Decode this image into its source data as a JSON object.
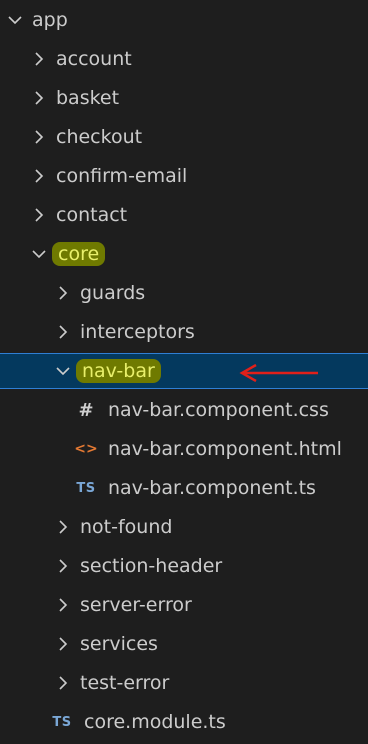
{
  "explorer": {
    "items": [
      {
        "label": "app",
        "depth": 0,
        "type": "folder",
        "expanded": true
      },
      {
        "label": "account",
        "depth": 1,
        "type": "folder",
        "expanded": false
      },
      {
        "label": "basket",
        "depth": 1,
        "type": "folder",
        "expanded": false
      },
      {
        "label": "checkout",
        "depth": 1,
        "type": "folder",
        "expanded": false
      },
      {
        "label": "confirm-email",
        "depth": 1,
        "type": "folder",
        "expanded": false
      },
      {
        "label": "contact",
        "depth": 1,
        "type": "folder",
        "expanded": false
      },
      {
        "label": "core",
        "depth": 1,
        "type": "folder",
        "expanded": true,
        "highlighted": true
      },
      {
        "label": "guards",
        "depth": 2,
        "type": "folder",
        "expanded": false
      },
      {
        "label": "interceptors",
        "depth": 2,
        "type": "folder",
        "expanded": false
      },
      {
        "label": "nav-bar",
        "depth": 2,
        "type": "folder",
        "expanded": true,
        "highlighted": true,
        "selected": true
      },
      {
        "label": "nav-bar.component.css",
        "depth": 3,
        "type": "file",
        "icon": "css-hash-icon",
        "icon_text": "#"
      },
      {
        "label": "nav-bar.component.html",
        "depth": 3,
        "type": "file",
        "icon": "html-brackets-icon",
        "icon_text": "<>"
      },
      {
        "label": "nav-bar.component.ts",
        "depth": 3,
        "type": "file",
        "icon": "typescript-icon",
        "icon_text": "TS"
      },
      {
        "label": "not-found",
        "depth": 2,
        "type": "folder",
        "expanded": false
      },
      {
        "label": "section-header",
        "depth": 2,
        "type": "folder",
        "expanded": false
      },
      {
        "label": "server-error",
        "depth": 2,
        "type": "folder",
        "expanded": false
      },
      {
        "label": "services",
        "depth": 2,
        "type": "folder",
        "expanded": false
      },
      {
        "label": "test-error",
        "depth": 2,
        "type": "folder",
        "expanded": false
      },
      {
        "label": "core.module.ts",
        "depth": 2,
        "type": "file",
        "icon": "typescript-icon",
        "icon_text": "TS"
      }
    ]
  },
  "annotation": {
    "icon": "red-arrow-icon",
    "points_to": "nav-bar"
  },
  "colors": {
    "background": "#1e1e1e",
    "text": "#cccccc",
    "selection": "#04395e",
    "selection_border": "#2f7fd4",
    "highlight": "#6f7a00",
    "highlight_text": "#e8ef6a",
    "html_icon": "#e37933",
    "ts_icon": "#7aa7d6",
    "arrow": "#e0201a"
  }
}
